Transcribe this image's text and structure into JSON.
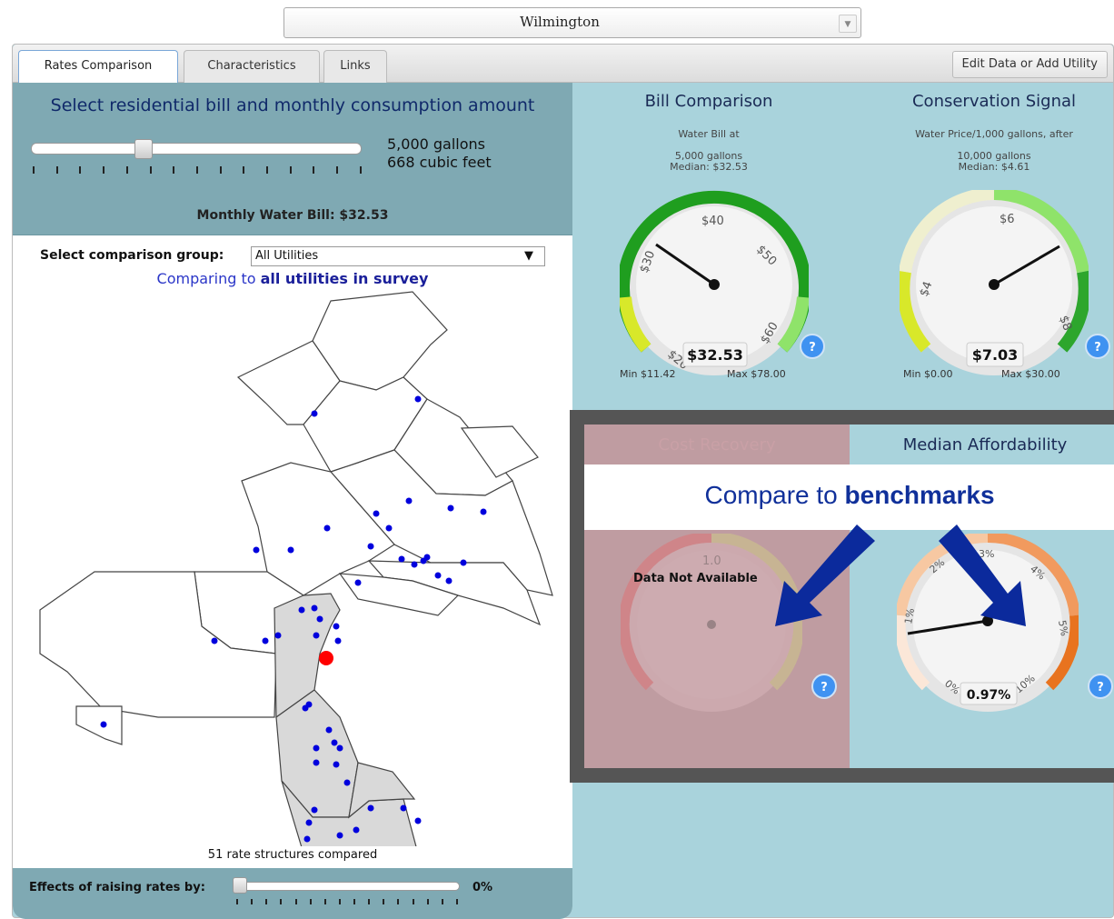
{
  "utility_select": {
    "value": "Wilmington"
  },
  "tabs": [
    {
      "label": "Rates Comparison",
      "active": true
    },
    {
      "label": "Characteristics",
      "active": false
    },
    {
      "label": "Links",
      "active": false
    }
  ],
  "edit_button": "Edit Data or Add Utility",
  "left": {
    "title": "Select residential bill and monthly consumption amount",
    "consumption": {
      "gallons": "5,000 gallons",
      "cubic_feet": "668 cubic feet",
      "slider_fraction": 0.33
    },
    "monthly_bill": "Monthly Water Bill: $32.53",
    "comparison_label": "Select comparison group:",
    "comparison_value": "All Utilities",
    "comparison_note_prefix": "Comparing to ",
    "comparison_note_bold": "all utilities in survey",
    "rate_count": "51 rate structures compared",
    "raise_label": "Effects of raising rates by:",
    "raise_value": "0%",
    "raise_fraction": 0.0,
    "highlight_color": "#ff0000",
    "dot_color": "#0000dd"
  },
  "gauges": {
    "bill": {
      "title": "Bill Comparison",
      "sub1": "Water Bill at",
      "sub2": "5,000 gallons",
      "sub3": "Median: $32.53",
      "value": "$32.53",
      "min": "Min $11.42",
      "max": "Max $78.00",
      "ticks": [
        "$20",
        "$30",
        "$40",
        "$50",
        "$60"
      ]
    },
    "conservation": {
      "title": "Conservation Signal",
      "sub1": "Water Price/1,000 gallons, after",
      "sub2": "10,000 gallons",
      "sub3": "Median: $4.61",
      "value": "$7.03",
      "min": "Min $0.00",
      "max": "Max $30.00",
      "ticks": [
        "$4",
        "$6",
        "$8"
      ]
    },
    "cost_recovery": {
      "title": "Cost Recovery",
      "message": "Data Not Available",
      "tick": "1.0"
    },
    "affordability": {
      "title": "Median Affordability",
      "value": "0.97%",
      "ticks": [
        "1%",
        "2%",
        "3%",
        "4%",
        "5%",
        "0%",
        "10%"
      ]
    }
  },
  "help_label": "?",
  "banner": {
    "prefix": "Compare to ",
    "bold": "benchmarks"
  }
}
